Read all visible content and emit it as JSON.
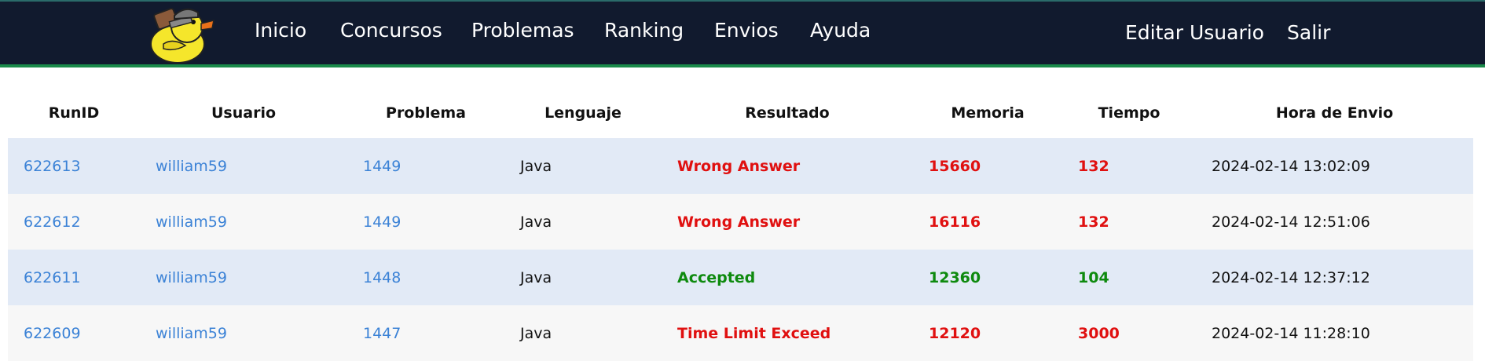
{
  "nav": {
    "items": [
      "Inicio",
      "Concursos",
      "Problemas",
      "Ranking",
      "Envios",
      "Ayuda"
    ],
    "right_items": [
      "Editar Usuario",
      "Salir"
    ]
  },
  "colors": {
    "navbar_bg": "#111a2e",
    "link": "#3b82d6",
    "wrong": "#e01010",
    "accepted": "#0e8a0e"
  },
  "table": {
    "headers": [
      "RunID",
      "Usuario",
      "Problema",
      "Lenguaje",
      "Resultado",
      "Memoria",
      "Tiempo",
      "Hora de Envio"
    ],
    "rows": [
      {
        "run_id": "622613",
        "user": "william59",
        "problem": "1449",
        "language": "Java",
        "result": "Wrong Answer",
        "memory": "15660",
        "time": "132",
        "submitted": "2024-02-14 13:02:09",
        "status": "wrong"
      },
      {
        "run_id": "622612",
        "user": "william59",
        "problem": "1449",
        "language": "Java",
        "result": "Wrong Answer",
        "memory": "16116",
        "time": "132",
        "submitted": "2024-02-14 12:51:06",
        "status": "wrong"
      },
      {
        "run_id": "622611",
        "user": "william59",
        "problem": "1448",
        "language": "Java",
        "result": "Accepted",
        "memory": "12360",
        "time": "104",
        "submitted": "2024-02-14 12:37:12",
        "status": "accepted"
      },
      {
        "run_id": "622609",
        "user": "william59",
        "problem": "1447",
        "language": "Java",
        "result": "Time Limit Exceed",
        "memory": "12120",
        "time": "3000",
        "submitted": "2024-02-14 11:28:10",
        "status": "wrong"
      }
    ]
  }
}
